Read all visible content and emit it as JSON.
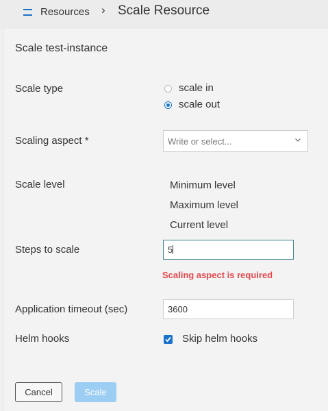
{
  "breadcrumb": {
    "parent": "Resources",
    "separator": "›",
    "current": "Scale Resource"
  },
  "form": {
    "title": "Scale test-instance",
    "scale_type": {
      "label": "Scale type",
      "options": [
        "scale in",
        "scale out"
      ],
      "selected": "scale out"
    },
    "scaling_aspect": {
      "label": "Scaling aspect *",
      "placeholder": "Write or select..."
    },
    "scale_level": {
      "label": "Scale level",
      "items": [
        "Minimum level",
        "Maximum level",
        "Current level"
      ]
    },
    "steps_to_scale": {
      "label": "Steps to scale",
      "value": "5",
      "error": "Scaling aspect is required"
    },
    "application_timeout": {
      "label": "Application timeout (sec)",
      "value": "3600"
    },
    "helm_hooks": {
      "label": "Helm hooks",
      "checkbox_label": "Skip helm hooks",
      "checked": true
    }
  },
  "actions": {
    "cancel": "Cancel",
    "scale": "Scale"
  },
  "colors": {
    "accent": "#1a73c9",
    "error": "#e8474b",
    "disabled_button": "#9ccdf2"
  }
}
